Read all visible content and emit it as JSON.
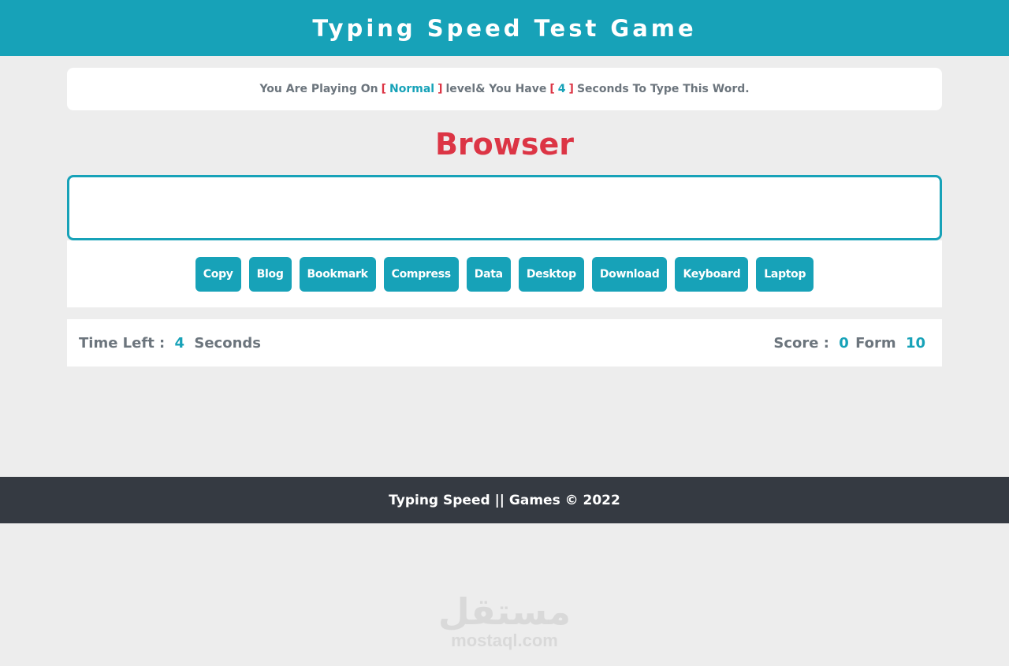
{
  "header": {
    "title": "Typing Speed Test Game"
  },
  "message": {
    "prefix": "You Are Playing On",
    "open_bracket": "[",
    "level": "Normal",
    "close_bracket": "]",
    "middle": "level& You Have",
    "seconds_value": "4",
    "suffix": "Seconds To Type This Word."
  },
  "current_word": "Browser",
  "input": {
    "value": "",
    "placeholder": ""
  },
  "upcoming_words": [
    "Copy",
    "Blog",
    "Bookmark",
    "Compress",
    "Data",
    "Desktop",
    "Download",
    "Keyboard",
    "Laptop"
  ],
  "control": {
    "time_label": "Time Left :",
    "time_value": "4",
    "time_unit": "Seconds",
    "score_label": "Score :",
    "score_value": "0",
    "score_from_label": "Form",
    "score_total": "10"
  },
  "footer": {
    "text": "Typing Speed || Games © 2022"
  },
  "watermark": {
    "arabic": "مستقل",
    "latin": "mostaql.com"
  },
  "colors": {
    "accent": "#17a2b8",
    "word": "#dc3545",
    "footer_bg": "#353a42",
    "page_bg": "#ededed",
    "text_muted": "#6c757d"
  }
}
